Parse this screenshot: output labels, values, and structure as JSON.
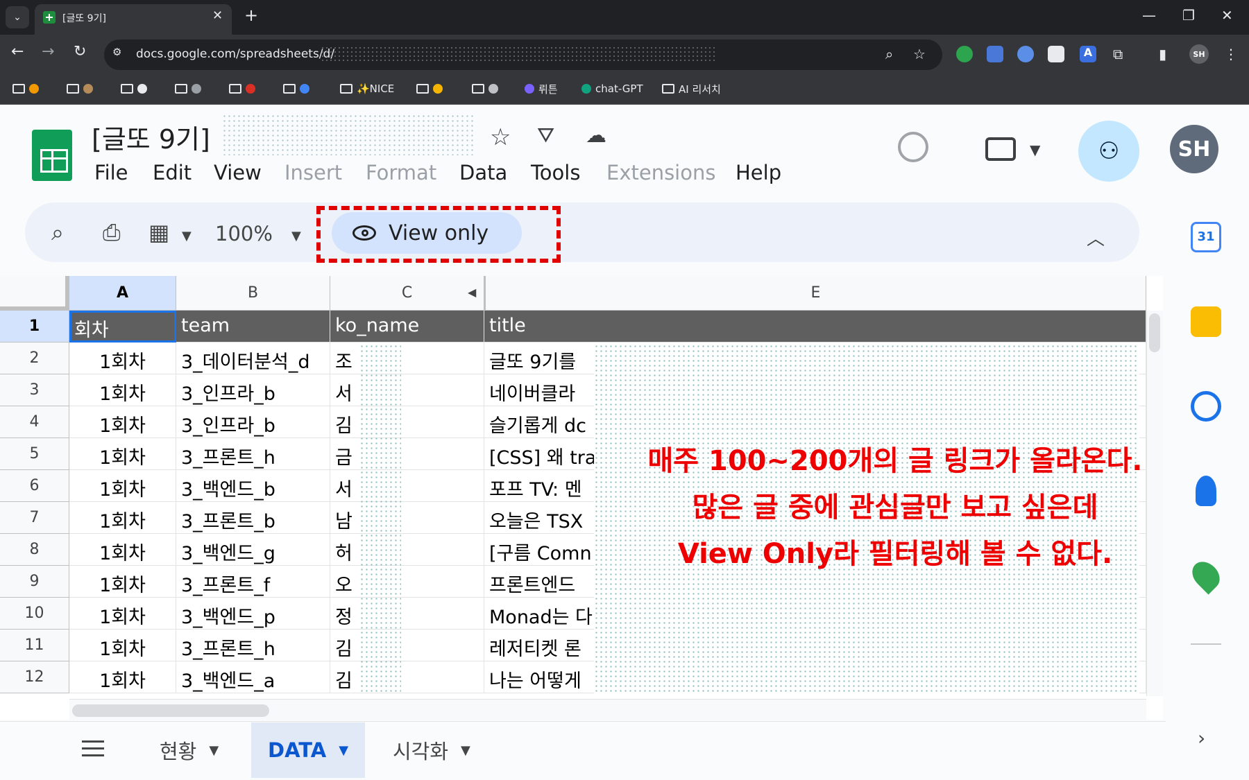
{
  "browser": {
    "tab_title": "[글또 9기]",
    "url": "docs.google.com/spreadsheets/d/",
    "bookmarks": [
      "✨NICE",
      "뤼튼",
      "chat-GPT",
      "AI 리서치"
    ]
  },
  "doc": {
    "title": "[글또 9기]",
    "menus": [
      "File",
      "Edit",
      "View",
      "Insert",
      "Format",
      "Data",
      "Tools",
      "Extensions",
      "Help"
    ],
    "disabled_menus": [
      "Insert",
      "Format",
      "Extensions"
    ],
    "avatar_initials": "SH"
  },
  "toolbar": {
    "zoom": "100%",
    "view_only": "View only"
  },
  "grid": {
    "columns": [
      "A",
      "B",
      "C",
      "E"
    ],
    "header_row": {
      "row": "1",
      "cells": [
        "회차",
        "team",
        "ko_name",
        "title"
      ]
    },
    "rows": [
      {
        "row": "2",
        "cells": [
          "1회차",
          "3_데이터분석_d",
          "조",
          "글또 9기를"
        ]
      },
      {
        "row": "3",
        "cells": [
          "1회차",
          "3_인프라_b",
          "서",
          "네이버클라"
        ]
      },
      {
        "row": "4",
        "cells": [
          "1회차",
          "3_인프라_b",
          "김",
          "슬기롭게 dc"
        ]
      },
      {
        "row": "5",
        "cells": [
          "1회차",
          "3_프론트_h",
          "금",
          "[CSS] 왜 tra"
        ]
      },
      {
        "row": "6",
        "cells": [
          "1회차",
          "3_백엔드_b",
          "서",
          "포프 TV: 멘"
        ]
      },
      {
        "row": "7",
        "cells": [
          "1회차",
          "3_프론트_b",
          "남",
          "오늘은 TSX"
        ]
      },
      {
        "row": "8",
        "cells": [
          "1회차",
          "3_백엔드_g",
          "허",
          "[구름 Comn"
        ]
      },
      {
        "row": "9",
        "cells": [
          "1회차",
          "3_프론트_f",
          "오",
          "프론트엔드"
        ]
      },
      {
        "row": "10",
        "cells": [
          "1회차",
          "3_백엔드_p",
          "정",
          "Monad는 다"
        ]
      },
      {
        "row": "11",
        "cells": [
          "1회차",
          "3_프론트_h",
          "김",
          "레저티켓 론"
        ]
      },
      {
        "row": "12",
        "cells": [
          "1회차",
          "3_백엔드_a",
          "김",
          "나는 어떻게"
        ]
      }
    ]
  },
  "annotation": {
    "lines": [
      "매주 100~200개의 글 링크가 올라온다.",
      "많은 글 중에 관심글만 보고 싶은데",
      "View Only라 필터링해 볼 수 없다."
    ],
    "color": "#ee0000"
  },
  "sheets": {
    "tabs": [
      "현황",
      "DATA",
      "시각화"
    ],
    "active": "DATA"
  }
}
